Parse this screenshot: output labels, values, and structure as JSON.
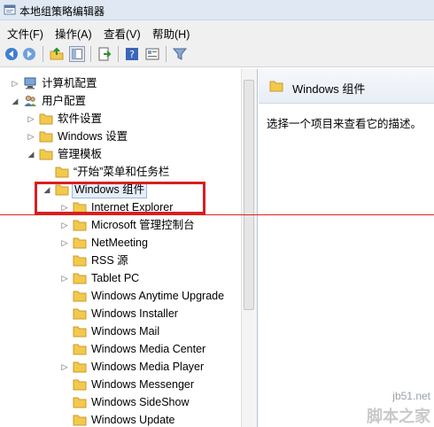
{
  "window": {
    "title": "本地组策略编辑器"
  },
  "menu": [
    "文件(F)",
    "操作(A)",
    "查看(V)",
    "帮助(H)"
  ],
  "toolbar": {
    "icons": [
      "back-arrow-icon",
      "forward-arrow-icon",
      "up-folder-icon",
      "show-hide-tree-icon",
      "export-list-icon",
      "help-icon",
      "properties-view-icon",
      "filter-icon"
    ]
  },
  "tree": [
    {
      "label": "计算机配置",
      "icon": "computer-icon",
      "expander": "collapsed",
      "indent": 0
    },
    {
      "label": "用户配置",
      "icon": "users-icon",
      "expander": "expanded",
      "indent": 0
    },
    {
      "label": "软件设置",
      "icon": "folder-icon",
      "expander": "collapsed",
      "indent": 1
    },
    {
      "label": "Windows 设置",
      "icon": "folder-icon",
      "expander": "collapsed",
      "indent": 1
    },
    {
      "label": "管理模板",
      "icon": "folder-icon",
      "expander": "expanded",
      "indent": 1
    },
    {
      "label": "“开始”菜单和任务栏",
      "icon": "folder-icon",
      "expander": "none",
      "indent": 2
    },
    {
      "label": "Windows 组件",
      "icon": "folder-icon",
      "expander": "expanded",
      "indent": 2,
      "selected": true
    },
    {
      "label": "Internet Explorer",
      "icon": "folder-icon",
      "expander": "collapsed",
      "indent": 3
    },
    {
      "label": "Microsoft 管理控制台",
      "icon": "folder-icon",
      "expander": "collapsed",
      "indent": 3
    },
    {
      "label": "NetMeeting",
      "icon": "folder-icon",
      "expander": "collapsed",
      "indent": 3
    },
    {
      "label": "RSS 源",
      "icon": "folder-icon",
      "expander": "none",
      "indent": 3
    },
    {
      "label": "Tablet PC",
      "icon": "folder-icon",
      "expander": "collapsed",
      "indent": 3
    },
    {
      "label": "Windows Anytime Upgrade",
      "icon": "folder-icon",
      "expander": "none",
      "indent": 3
    },
    {
      "label": "Windows Installer",
      "icon": "folder-icon",
      "expander": "none",
      "indent": 3
    },
    {
      "label": "Windows Mail",
      "icon": "folder-icon",
      "expander": "none",
      "indent": 3
    },
    {
      "label": "Windows Media Center",
      "icon": "folder-icon",
      "expander": "none",
      "indent": 3
    },
    {
      "label": "Windows Media Player",
      "icon": "folder-icon",
      "expander": "collapsed",
      "indent": 3
    },
    {
      "label": "Windows Messenger",
      "icon": "folder-icon",
      "expander": "none",
      "indent": 3
    },
    {
      "label": "Windows SideShow",
      "icon": "folder-icon",
      "expander": "none",
      "indent": 3
    },
    {
      "label": "Windows Update",
      "icon": "folder-icon",
      "expander": "none",
      "indent": 3
    }
  ],
  "right_pane": {
    "title": "Windows 组件",
    "description": "选择一个项目来查看它的描述。"
  },
  "watermark": {
    "site": "jb51.net",
    "name": "脚本之家"
  },
  "colors": {
    "annotation": "#d62020",
    "folder": "#f2c94c",
    "selection": "#e5eef9"
  }
}
